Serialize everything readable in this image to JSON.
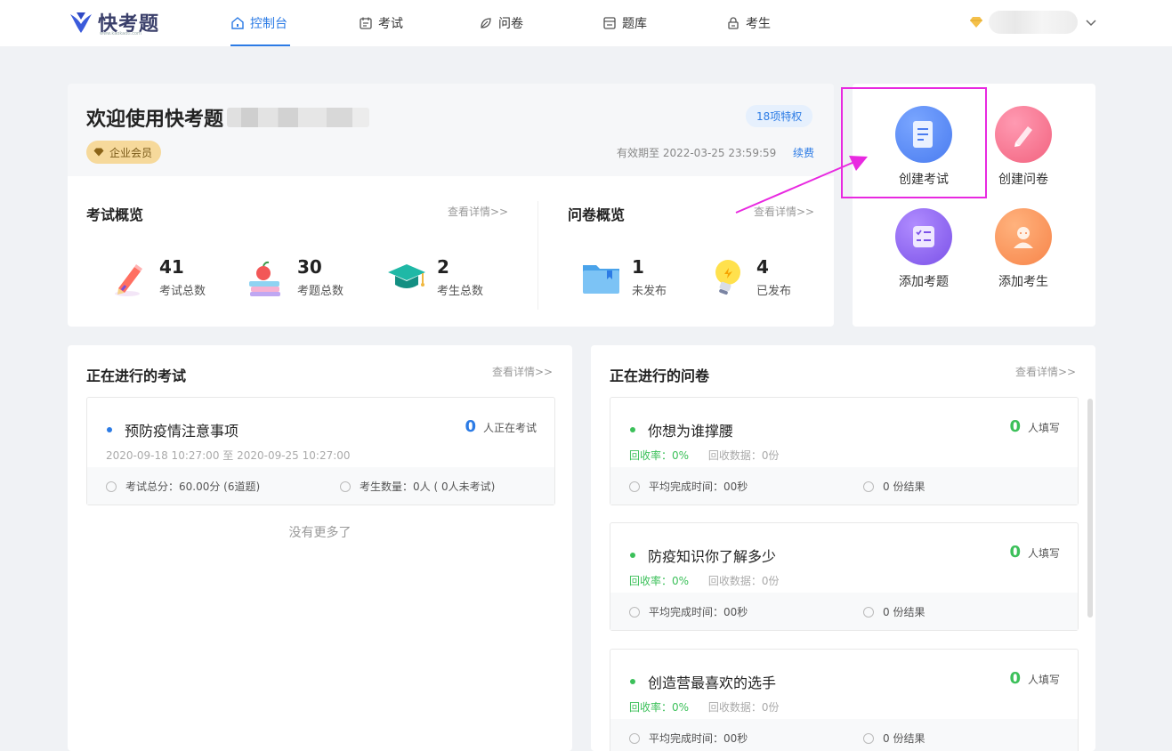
{
  "header": {
    "logo_text": "快考题",
    "logo_sub": "www.kaokaoti.com",
    "nav": [
      {
        "label": "控制台",
        "icon": "home-icon",
        "active": true
      },
      {
        "label": "考试",
        "icon": "calendar-icon"
      },
      {
        "label": "问卷",
        "icon": "leaf-icon"
      },
      {
        "label": "题库",
        "icon": "database-icon"
      },
      {
        "label": "考生",
        "icon": "lock-user-icon"
      }
    ]
  },
  "welcome": {
    "title": "欢迎使用快考题",
    "privilege": "18项特权",
    "member": "企业会员",
    "valid_until": "有效期至 2022-03-25 23:59:59",
    "renew": "续费"
  },
  "exam_overview": {
    "title": "考试概览",
    "detail": "查看详情>>",
    "stats": [
      {
        "value": "41",
        "label": "考试总数"
      },
      {
        "value": "30",
        "label": "考题总数"
      },
      {
        "value": "2",
        "label": "考生总数"
      }
    ]
  },
  "survey_overview": {
    "title": "问卷概览",
    "detail": "查看详情>>",
    "stats": [
      {
        "value": "1",
        "label": "未发布"
      },
      {
        "value": "4",
        "label": "已发布"
      }
    ]
  },
  "quick_actions": [
    {
      "label": "创建考试",
      "color": "#5b8ef5"
    },
    {
      "label": "创建问卷",
      "color": "#f66f8f"
    },
    {
      "label": "添加考题",
      "color": "#8a5ef0"
    },
    {
      "label": "添加考生",
      "color": "#f7904a"
    }
  ],
  "ongoing_exams": {
    "title": "正在进行的考试",
    "detail": "查看详情>>",
    "items": [
      {
        "title": "预防疫情注意事项",
        "count": "0",
        "count_label": "人正在考试",
        "time": "2020-09-18 10:27:00 至 2020-09-25 10:27:00",
        "score": "考试总分：60.00分 (6道题)",
        "candidates": "考生数量：0人 ( 0人未考试)"
      }
    ],
    "no_more": "没有更多了"
  },
  "ongoing_surveys": {
    "title": "正在进行的问卷",
    "detail": "查看详情>>",
    "items": [
      {
        "title": "你想为谁撑腰",
        "count": "0",
        "count_label": "人填写",
        "rate": "回收率：0%",
        "data": "回收数据：0份",
        "avg": "平均完成时间：00秒",
        "results": "0 份结果"
      },
      {
        "title": "防疫知识你了解多少",
        "count": "0",
        "count_label": "人填写",
        "rate": "回收率：0%",
        "data": "回收数据：0份",
        "avg": "平均完成时间：00秒",
        "results": "0 份结果"
      },
      {
        "title": "创造营最喜欢的选手",
        "count": "0",
        "count_label": "人填写",
        "rate": "回收率：0%",
        "data": "回收数据：0份",
        "avg": "平均完成时间：00秒",
        "results": "0 份结果"
      }
    ]
  },
  "colors": {
    "accent": "#2c7be5",
    "green": "#3cc05a",
    "annotation": "#e829e0"
  }
}
